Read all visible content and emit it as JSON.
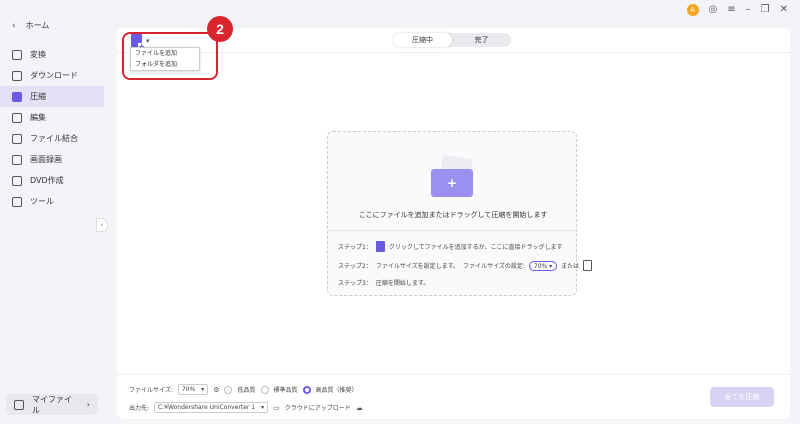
{
  "sidebar": {
    "home_label": "ホーム",
    "items": [
      {
        "label": "変換",
        "icon": "convert-icon"
      },
      {
        "label": "ダウンロード",
        "icon": "download-icon"
      },
      {
        "label": "圧縮",
        "icon": "compress-icon",
        "active": true
      },
      {
        "label": "編集",
        "icon": "edit-icon"
      },
      {
        "label": "ファイル結合",
        "icon": "merge-icon"
      },
      {
        "label": "画面録画",
        "icon": "screen-record-icon"
      },
      {
        "label": "DVD作成",
        "icon": "dvd-icon"
      },
      {
        "label": "ツール",
        "icon": "toolbox-icon"
      }
    ],
    "my_file_label": "マイファイル"
  },
  "titlebar": {
    "avatar_letter": "A"
  },
  "toolbar": {
    "tab_compressing": "圧縮中",
    "tab_done": "完了"
  },
  "dropdown": {
    "add_file": "ファイルを追加",
    "add_folder": "フォルダを追加"
  },
  "annotation": {
    "badge_number": "2",
    "color": "#d9262e"
  },
  "dropzone": {
    "main_text": "ここにファイルを追加またはドラッグして圧縮を開始します",
    "step1_label": "ステップ1：",
    "step1_text": "クリックしてファイルを追加するか、ここに直接ドラッグします",
    "step2_label": "ステップ2：",
    "step2_text": "ファイルサイズを設定します。",
    "step2_setting": "ファイルサイズの設定:",
    "step2_value": "70%",
    "step2_or": "または",
    "step3_label": "ステップ3：",
    "step3_text": "圧縮を開始します。"
  },
  "bottom": {
    "file_size_label": "ファイルサイズ:",
    "file_size_value": "70%",
    "quality_low": "低品質",
    "quality_standard": "標準品質",
    "quality_high": "高品質（推奨）",
    "output_label": "出力先:",
    "output_path": "C:¥Wondershare UniConverter 1",
    "cloud_upload": "クラウドにアップロード",
    "compress_all": "全てを圧縮"
  },
  "colors": {
    "accent": "#6b5be0",
    "highlight": "#d9262e"
  }
}
